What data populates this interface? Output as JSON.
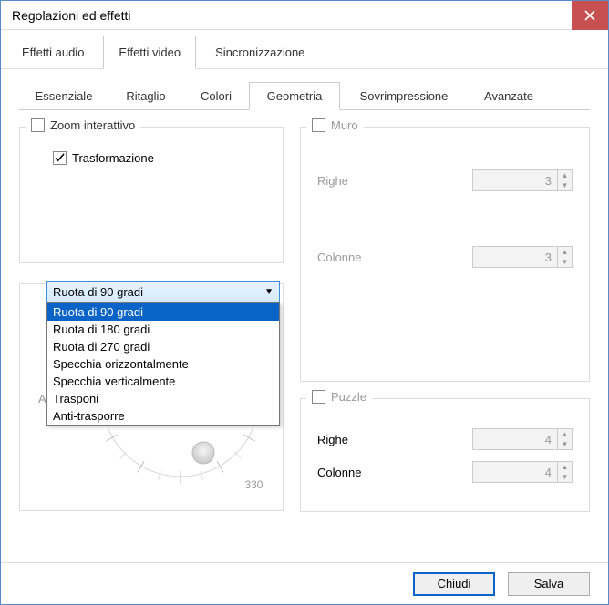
{
  "window": {
    "title": "Regolazioni ed effetti"
  },
  "main_tabs": {
    "t0": "Effetti audio",
    "t1": "Effetti video",
    "t2": "Sincronizzazione",
    "active": 1
  },
  "sub_tabs": {
    "s0": "Essenziale",
    "s1": "Ritaglio",
    "s2": "Colori",
    "s3": "Geometria",
    "s4": "Sovrimpressione",
    "s5": "Avanzate",
    "active": 3
  },
  "zoom": {
    "label": "Zoom interattivo",
    "checked": false
  },
  "trasf": {
    "label": "Trasformazione",
    "checked": true
  },
  "dropdown": {
    "selected": "Ruota di 90 gradi",
    "items": {
      "i0": "Ruota di 90 gradi",
      "i1": "Ruota di 180 gradi",
      "i2": "Ruota di 270 gradi",
      "i3": "Specchia orizzontalmente",
      "i4": "Specchia verticalmente",
      "i5": "Trasponi",
      "i6": "Anti-trasporre"
    }
  },
  "rotaz": {
    "angolo_label": "Angolo",
    "tick_330": "330"
  },
  "muro": {
    "label": "Muro",
    "checked": false,
    "righe_label": "Righe",
    "righe_val": "3",
    "colonne_label": "Colonne",
    "colonne_val": "3"
  },
  "puzzle": {
    "label": "Puzzle",
    "checked": false,
    "righe_label": "Righe",
    "righe_val": "4",
    "colonne_label": "Colonne",
    "colonne_val": "4"
  },
  "footer": {
    "close": "Chiudi",
    "save": "Salva"
  }
}
